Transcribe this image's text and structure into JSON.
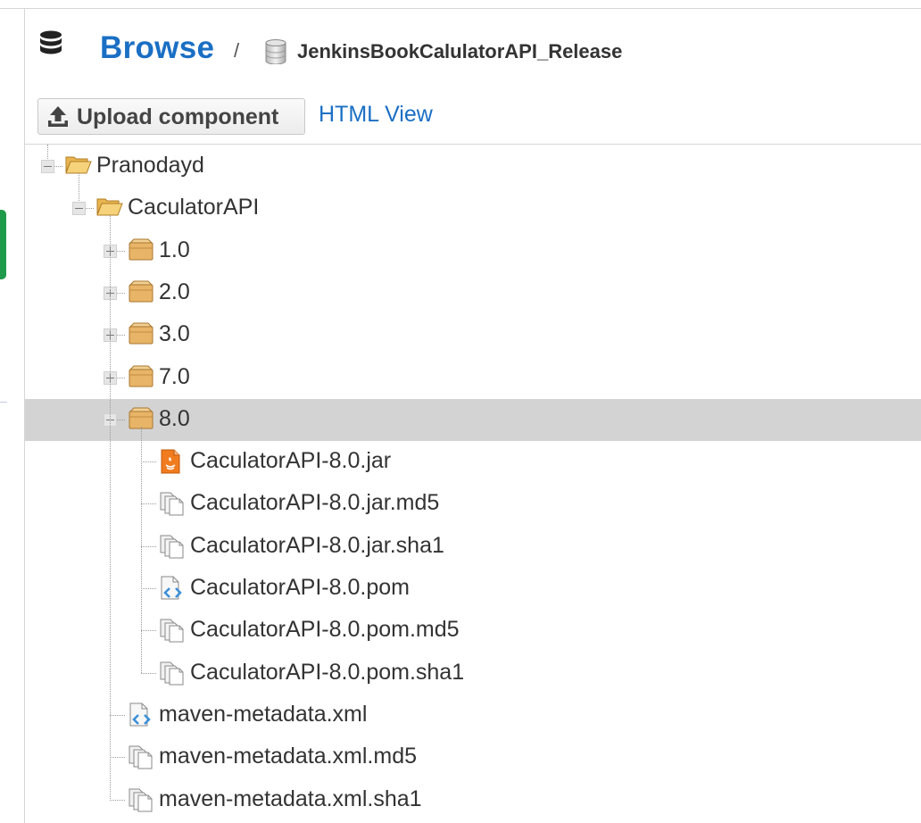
{
  "header": {
    "browse_label": "Browse",
    "separator": "/",
    "repository_name": "JenkinsBookCalulatorAPI_Release",
    "icons": [
      "database-icon",
      "repository-icon"
    ]
  },
  "toolbar": {
    "upload_label": "Upload component",
    "html_view_label": "HTML View",
    "icons": [
      "upload-icon"
    ]
  },
  "colors": {
    "link": "#1a6fc4",
    "selected_row": "#d3d3d3",
    "folder": "#f3c96a",
    "package": "#e8b468",
    "jar": "#f07c1f",
    "xml_badge": "#3a8fd8"
  },
  "tree": {
    "nodes": [
      {
        "label": "Pranodayd",
        "type": "folder-open",
        "toggle": "minus"
      },
      {
        "label": "CaculatorAPI",
        "type": "folder-open",
        "toggle": "minus"
      },
      {
        "label": "1.0",
        "type": "package",
        "toggle": "plus"
      },
      {
        "label": "2.0",
        "type": "package",
        "toggle": "plus"
      },
      {
        "label": "3.0",
        "type": "package",
        "toggle": "plus"
      },
      {
        "label": "7.0",
        "type": "package",
        "toggle": "plus"
      },
      {
        "label": "8.0",
        "type": "package",
        "toggle": "minus",
        "selected": true
      },
      {
        "label": "CaculatorAPI-8.0.jar",
        "type": "jar-file"
      },
      {
        "label": "CaculatorAPI-8.0.jar.md5",
        "type": "checksum-file"
      },
      {
        "label": "CaculatorAPI-8.0.jar.sha1",
        "type": "checksum-file"
      },
      {
        "label": "CaculatorAPI-8.0.pom",
        "type": "xml-file"
      },
      {
        "label": "CaculatorAPI-8.0.pom.md5",
        "type": "checksum-file"
      },
      {
        "label": "CaculatorAPI-8.0.pom.sha1",
        "type": "checksum-file"
      },
      {
        "label": "maven-metadata.xml",
        "type": "xml-file"
      },
      {
        "label": "maven-metadata.xml.md5",
        "type": "checksum-file"
      },
      {
        "label": "maven-metadata.xml.sha1",
        "type": "checksum-file"
      }
    ]
  }
}
